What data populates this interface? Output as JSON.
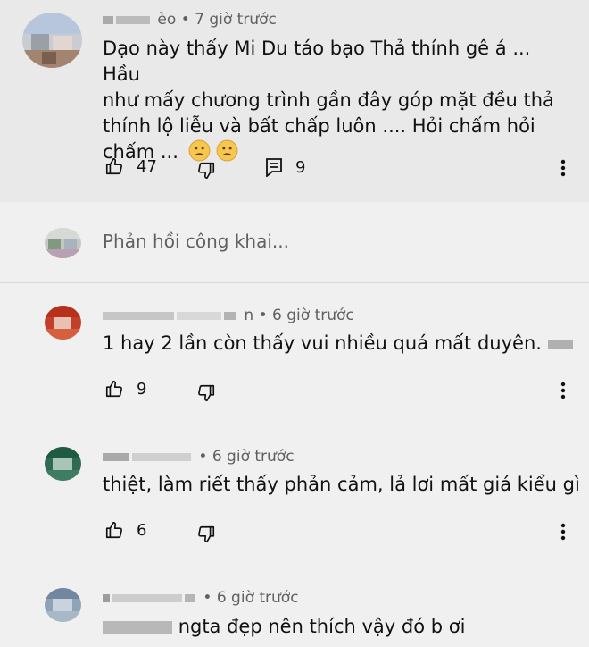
{
  "comments": [
    {
      "author": "èo",
      "time": "• 7 giờ trước",
      "text_lines": [
        "Dạo này thấy Mi Du táo bạo Thả thính gê á ... Hầu",
        "như mấy chương trình gần đây góp mặt đều thả",
        "thính lộ liễu và bất chấp luôn .... Hỏi chấm hỏi",
        "chấm ..."
      ],
      "likes": "47",
      "replies": "9"
    },
    {
      "author": "n",
      "time": "• 6 giờ trước",
      "text": "1 hay 2 lần còn thấy vui nhiều quá mất duyên.",
      "likes": "9"
    },
    {
      "time": "• 6 giờ trước",
      "text": "thiệt, làm riết thấy phản cảm, lả lơi mất giá kiểu gì",
      "likes": "6"
    },
    {
      "time": "• 6 giờ trước",
      "text": "ngta đẹp nên thích vậy đó b ơi"
    }
  ],
  "reply_box": {
    "placeholder": "Phản hồi công khai..."
  },
  "icons": [
    "like-icon",
    "dislike-icon",
    "reply-icon",
    "more-vert-icon",
    "confused-emoji-icon"
  ],
  "colors": {
    "background": "#f0f0f0",
    "highlight": "#e9e9e9",
    "meta": "#606060"
  }
}
